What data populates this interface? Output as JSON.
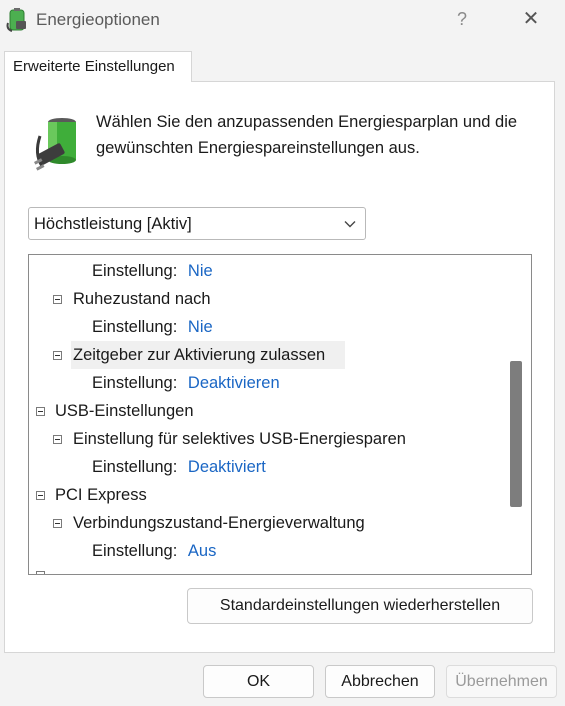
{
  "window": {
    "title": "Energieoptionen",
    "help_label": "?",
    "close_label": "✕"
  },
  "tab": {
    "label": "Erweiterte Einstellungen"
  },
  "intro_text": "Wählen Sie den anzupassenden Energiesparplan und die gewünschten Energiespareinstellungen aus.",
  "plan_select": {
    "value": "Höchstleistung [Aktiv]"
  },
  "tree": {
    "setting_prefix": "Einstellung:",
    "rows": [
      {
        "label": "",
        "value": "Nie"
      },
      {
        "label": "Ruhezustand nach"
      },
      {
        "label": "",
        "value": "Nie"
      },
      {
        "label": "Zeitgeber zur Aktivierung zulassen"
      },
      {
        "label": "",
        "value": "Deaktivieren"
      },
      {
        "label": "USB-Einstellungen"
      },
      {
        "label": "Einstellung für selektives USB-Energiesparen"
      },
      {
        "label": "",
        "value": "Deaktiviert"
      },
      {
        "label": "PCI Express"
      },
      {
        "label": "Verbindungszustand-Energieverwaltung"
      },
      {
        "label": "",
        "value": "Aus"
      }
    ]
  },
  "buttons": {
    "restore": "Standardeinstellungen wiederherstellen",
    "ok": "OK",
    "cancel": "Abbrechen",
    "apply": "Übernehmen"
  },
  "colors": {
    "value_link": "#1a66c4",
    "battery_green": "#3fae3a"
  },
  "icons": {
    "app": "battery-plug-icon",
    "dropdown": "chevron-down-icon"
  }
}
